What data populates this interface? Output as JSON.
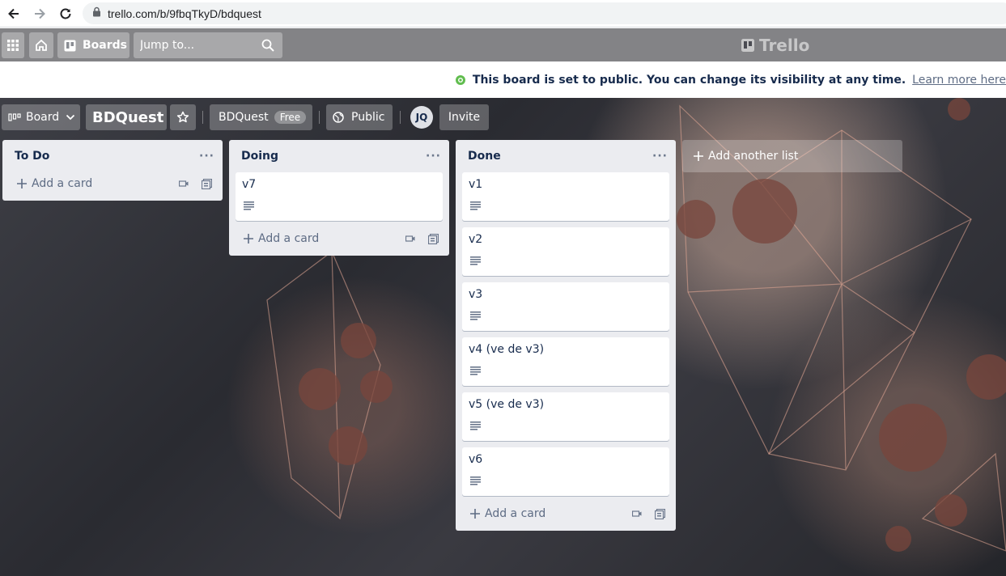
{
  "browser": {
    "url": "trello.com/b/9fbqTkyD/bdquest"
  },
  "header": {
    "boards_label": "Boards",
    "search_placeholder": "Jump to...",
    "logo_text": "Trello"
  },
  "banner": {
    "message": "This board is set to public. You can change its visibility at any time.",
    "link": "Learn more here"
  },
  "board_bar": {
    "view_label": "Board",
    "board_name": "BDQuest",
    "workspace": "BDQuest",
    "plan_badge": "Free",
    "visibility": "Public",
    "avatar_initials": "JQ",
    "invite_label": "Invite"
  },
  "lists": [
    {
      "title": "To Do",
      "cards": [],
      "add_card": "Add a card"
    },
    {
      "title": "Doing",
      "cards": [
        "v7"
      ],
      "add_card": "Add a card"
    },
    {
      "title": "Done",
      "cards": [
        "v1",
        "v2",
        "v3",
        "v4 (ve de v3)",
        "v5 (ve de v3)",
        "v6"
      ],
      "add_card": "Add a card"
    }
  ],
  "add_list_label": "Add another list",
  "colors": {
    "list_bg": "#ebecf0",
    "text": "#172b4d",
    "muted": "#5e6c84",
    "public_icon": "#61bd4f"
  },
  "icons": [
    "back-arrow-icon",
    "forward-arrow-icon",
    "reload-icon",
    "lock-icon",
    "apps-grid-icon",
    "home-icon",
    "boards-icon",
    "search-icon",
    "trello-logo-icon",
    "globe-icon",
    "board-view-icon",
    "chevron-down-icon",
    "star-icon",
    "plus-icon",
    "description-icon",
    "template-icon",
    "card-template-icon"
  ]
}
